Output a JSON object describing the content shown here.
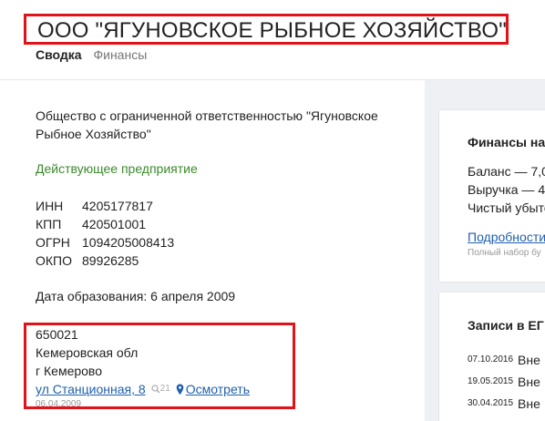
{
  "header": {
    "title": "ООО \"ЯГУНОВСКОЕ РЫБНОЕ ХОЗЯЙСТВО\"",
    "tabs": [
      {
        "label": "Сводка",
        "active": true
      },
      {
        "label": "Финансы",
        "active": false
      }
    ]
  },
  "company": {
    "full_name": "Общество с ограниченной ответственностью \"Ягуновское Рыбное Хозяйство\"",
    "status": "Действующее предприятие",
    "codes": [
      {
        "label": "ИНН",
        "value": "4205177817"
      },
      {
        "label": "КПП",
        "value": "420501001"
      },
      {
        "label": "ОГРН",
        "value": "1094205008413"
      },
      {
        "label": "ОКПО",
        "value": "89926285"
      }
    ],
    "founded": "Дата образования: 6 апреля 2009",
    "address": {
      "postcode": "650021",
      "region": "Кемеровская обл",
      "city": "г Кемерово",
      "street_link": "ул Станционная, 8",
      "search_count": "21",
      "view_link": "Осмотреть",
      "date": "06.04.2009"
    }
  },
  "sidebar": {
    "finances": {
      "title": "Финансы на",
      "lines": [
        "Баланс — 7,0",
        "Выручка — 4",
        "Чистый убыто"
      ],
      "details_link": "Подробности",
      "note": "Полный набор бу"
    },
    "registry": {
      "title": "Записи в ЕГ",
      "entries": [
        {
          "date": "07.10.2016",
          "text": "Вне"
        },
        {
          "date": "19.05.2015",
          "text": "Вне"
        },
        {
          "date": "30.04.2015",
          "text": "Вне"
        }
      ]
    }
  },
  "colors": {
    "highlight_border": "#e0121a",
    "status_green": "#3a8a2a",
    "link_blue": "#1f5fae",
    "sidebar_bg": "#eef0f3"
  }
}
